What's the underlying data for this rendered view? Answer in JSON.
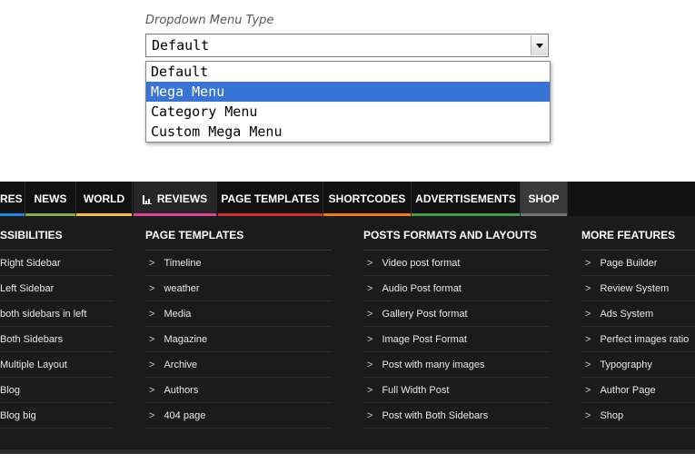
{
  "dropdown": {
    "label": "Dropdown Menu Type",
    "value": "Default",
    "options": [
      "Default",
      "Mega Menu",
      "Category Menu",
      "Custom Mega Menu"
    ],
    "selected_index": 1
  },
  "nav": {
    "tabs": [
      {
        "label": "RES",
        "color": "#1e88e5"
      },
      {
        "label": "NEWS",
        "color": "#7cb342"
      },
      {
        "label": "WORLD",
        "color": "#fbc02d"
      },
      {
        "label": "REVIEWS",
        "color": "#e040a0",
        "icon": "bar-chart-icon"
      },
      {
        "label": "PAGE TEMPLATES",
        "color": "#d32f2f"
      },
      {
        "label": "SHORTCODES",
        "color": "#f57c00"
      },
      {
        "label": "ADVERTISEMENTS",
        "color": "#43a047"
      },
      {
        "label": "SHOP",
        "color": "#757575"
      }
    ],
    "columns": [
      {
        "header": "SSIBILITIES",
        "items": [
          "Right Sidebar",
          "Left Sidebar",
          "both sidebars in left",
          "Both Sidebars",
          "Multiple Layout",
          "Blog",
          "Blog big"
        ]
      },
      {
        "header": "PAGE TEMPLATES",
        "items": [
          "Timeline",
          "weather",
          "Media",
          "Magazine",
          "Archive",
          "Authors",
          "404 page"
        ]
      },
      {
        "header": "POSTS FORMATS AND LAYOUTS",
        "items": [
          "Video post format",
          "Audio Post format",
          "Gallery Post format",
          "Image Post Format",
          "Post with many images",
          "Full Width Post",
          "Post with Both Sidebars"
        ]
      },
      {
        "header": "MORE FEATURES",
        "items": [
          "Page Builder",
          "Review System",
          "Ads System",
          "Perfect images ratio",
          "Typography",
          "Author Page",
          "Shop"
        ]
      }
    ],
    "chevron_glyph": ">"
  }
}
